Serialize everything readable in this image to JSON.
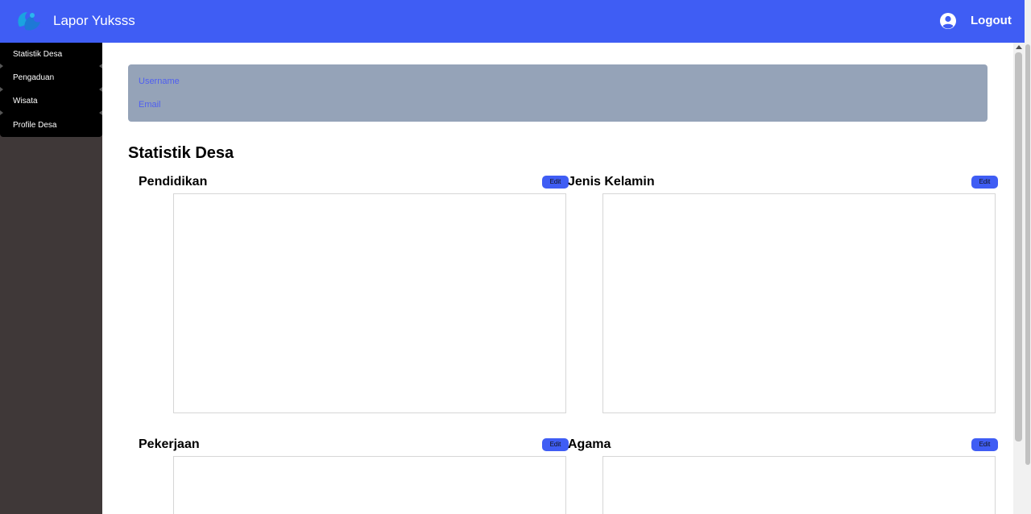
{
  "header": {
    "app_title": "Lapor Yuksss",
    "logout_label": "Logout",
    "bg_color": "#3f5df4"
  },
  "sidebar": {
    "items": [
      {
        "label": "Statistik Desa"
      },
      {
        "label": "Pengaduan"
      },
      {
        "label": "Wisata"
      },
      {
        "label": "Profile Desa"
      }
    ]
  },
  "profile": {
    "username_label": "Username",
    "email_label": "Email"
  },
  "main": {
    "section_title": "Statistik Desa",
    "stats": [
      {
        "title": "Pendidikan",
        "edit_label": "Edit"
      },
      {
        "title": "Jenis Kelamin",
        "edit_label": "Edit"
      },
      {
        "title": "Pekerjaan",
        "edit_label": "Edit"
      },
      {
        "title": "Agama",
        "edit_label": "Edit"
      }
    ]
  }
}
